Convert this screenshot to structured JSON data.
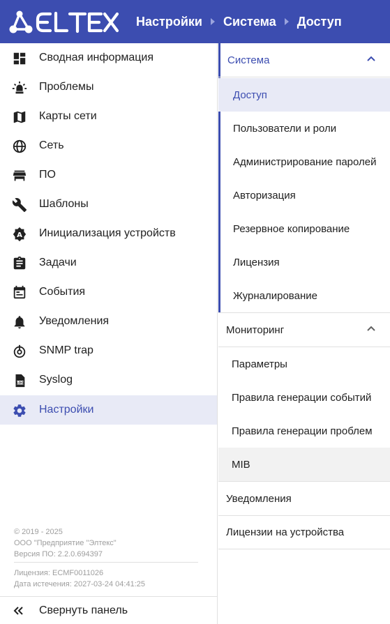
{
  "header": {
    "logo_text": "ELTEX",
    "breadcrumbs": [
      "Настройки",
      "Система",
      "Доступ"
    ],
    "bg_color": "#3c4db0"
  },
  "sidebar": {
    "items": [
      {
        "label": "Сводная информация",
        "icon": "dashboard-icon"
      },
      {
        "label": "Проблемы",
        "icon": "alarm-light-icon"
      },
      {
        "label": "Карты сети",
        "icon": "map-icon"
      },
      {
        "label": "Сеть",
        "icon": "globe-icon"
      },
      {
        "label": "ПО",
        "icon": "store-icon"
      },
      {
        "label": "Шаблоны",
        "icon": "wrench-icon"
      },
      {
        "label": "Инициализация устройств",
        "icon": "hexagon-a-icon"
      },
      {
        "label": "Задачи",
        "icon": "clipboard-icon"
      },
      {
        "label": "События",
        "icon": "calendar-icon"
      },
      {
        "label": "Уведомления",
        "icon": "bell-icon"
      },
      {
        "label": "SNMP trap",
        "icon": "snmp-trap-icon"
      },
      {
        "label": "Syslog",
        "icon": "log-file-icon"
      },
      {
        "label": "Настройки",
        "icon": "gear-icon",
        "active": true
      }
    ],
    "footer": {
      "copyright": "© 2019 - 2025",
      "company": "ООО \"Предприятие \"Элтекс\"",
      "version": "Версия ПО: 2.2.0.694397",
      "license": "Лицензия: ECMF0011026",
      "expiry": "Дата истечения: 2027-03-24 04:41:25"
    },
    "collapse_label": "Свернуть панель"
  },
  "panel": {
    "groups": [
      {
        "label": "Система",
        "expanded": true,
        "items": [
          "Доступ",
          "Пользователи и роли",
          "Администрирование паролей",
          "Авторизация",
          "Резервное копирование",
          "Лицензия",
          "Журналирование"
        ]
      },
      {
        "label": "Мониторинг",
        "expanded": true,
        "items": [
          "Параметры",
          "Правила генерации событий",
          "Правила генерации проблем",
          "MIB"
        ]
      },
      {
        "label": "Уведомления",
        "expanded": false,
        "items": []
      },
      {
        "label": "Лицензии на устройства",
        "expanded": false,
        "items": []
      }
    ],
    "active_item": "Доступ",
    "accent_color": "#3c4db0"
  }
}
